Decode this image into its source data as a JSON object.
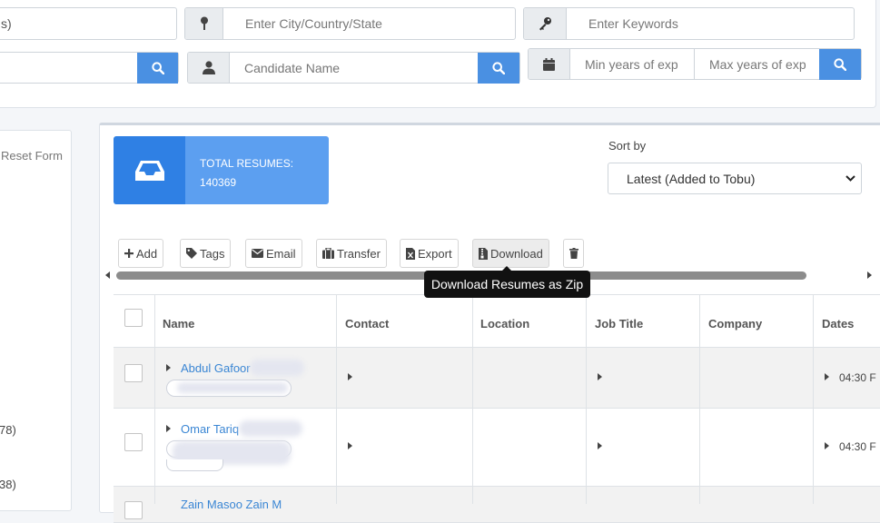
{
  "search": {
    "field1_value": "s)",
    "location_placeholder": "Enter City/Country/State",
    "keywords_placeholder": "Enter Keywords",
    "candidate_placeholder": "Candidate Name",
    "min_exp_placeholder": "Min years of exp",
    "max_exp_placeholder": "Max years of exp"
  },
  "filters": {
    "reset_label": "Reset Form",
    "count_1": "78)",
    "count_2": "38)"
  },
  "stats": {
    "total_label": "TOTAL RESUMES:",
    "total_value": "140369"
  },
  "sort": {
    "label": "Sort by",
    "selected": "Latest (Added to Tobu)"
  },
  "toolbar": {
    "add": "Add",
    "tags": "Tags",
    "email": "Email",
    "transfer": "Transfer",
    "export": "Export",
    "download": "Download"
  },
  "tooltip": "Download Resumes as Zip",
  "table": {
    "headers": [
      "Name",
      "Contact",
      "Location",
      "Job Title",
      "Company",
      "Dates"
    ],
    "rows": [
      {
        "name": "Abdul Gafoor",
        "date": "04:30 F"
      },
      {
        "name": "Omar Tariq",
        "date": "04:30 F"
      },
      {
        "name": "Zain Masoo Zain M",
        "date": ""
      }
    ]
  },
  "colors": {
    "primary": "#4a90e2",
    "stat_dark": "#2f80e4",
    "stat_light": "#5c9ff0",
    "link": "#3a86d4"
  }
}
